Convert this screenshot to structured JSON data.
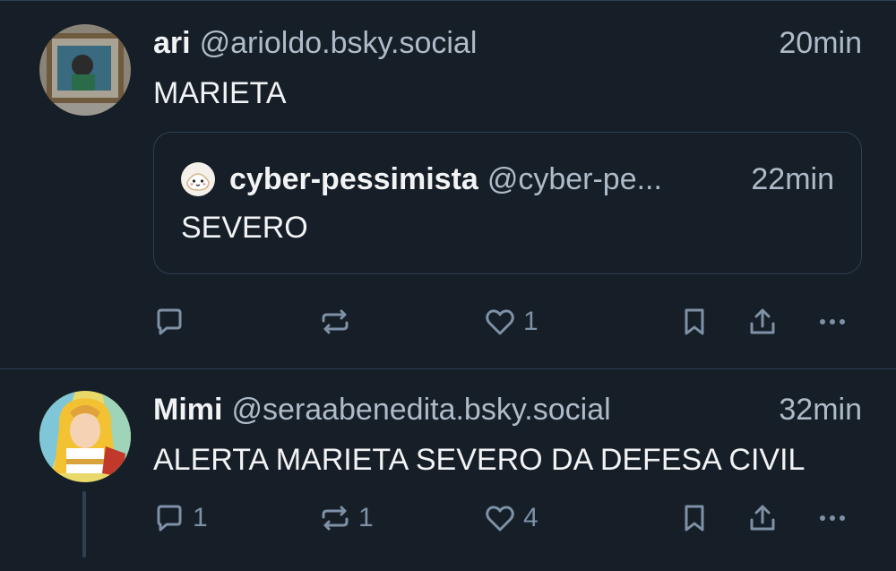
{
  "posts": [
    {
      "display_name": "ari",
      "handle": "@arioldo.bsky.social",
      "time": "20min",
      "text": "MARIETA",
      "quote": {
        "display_name": "cyber-pessimista",
        "handle": "@cyber-pe...",
        "time": "22min",
        "text": "SEVERO"
      },
      "actions": {
        "reply_count": "",
        "repost_count": "",
        "like_count": "1"
      }
    },
    {
      "display_name": "Mimi",
      "handle": "@seraabenedita.bsky.social",
      "time": "32min",
      "text": "ALERTA MARIETA SEVERO DA DEFESA CIVIL",
      "actions": {
        "reply_count": "1",
        "repost_count": "1",
        "like_count": "4"
      }
    }
  ],
  "icons": {
    "reply": "chat-bubble-icon",
    "repost": "repost-arrows-icon",
    "like": "heart-icon",
    "save": "bookmark-icon",
    "share": "share-icon",
    "more": "ellipsis-icon"
  },
  "colors": {
    "background": "#161e27",
    "text": "#f1f3f5",
    "muted": "#aebbc9",
    "icon": "#7e91a6",
    "border": "#2e4052"
  }
}
